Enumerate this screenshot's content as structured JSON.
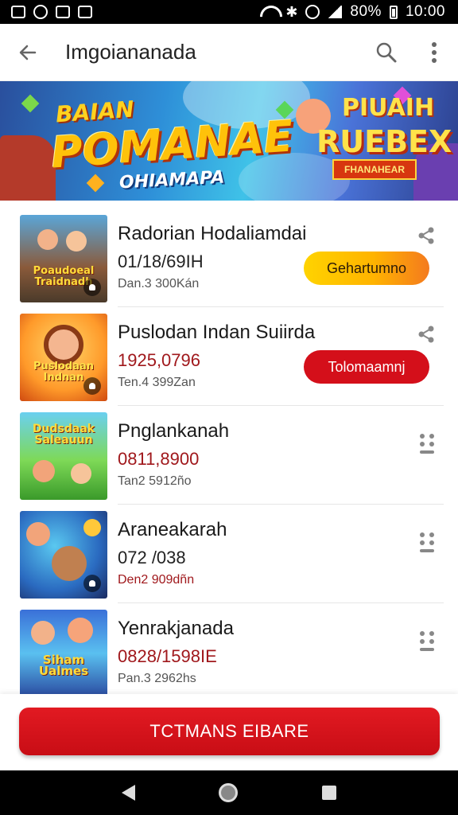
{
  "status_bar": {
    "battery": "80%",
    "time": "10:00",
    "left_icons": [
      "notification-icon",
      "circle-icon",
      "mail-icon",
      "photo-icon"
    ]
  },
  "app_bar": {
    "title": "Imgoiananada",
    "icons": [
      "back-arrow-icon",
      "search-icon",
      "more-vert-icon"
    ]
  },
  "banner": {
    "title_small": "BAIAN",
    "title_big": "POMANAE",
    "subtitle": "OHIAMAPA",
    "right_top": "PIUAIH",
    "right_big": "RUEBEX",
    "right_tag": "FHANAHEAR"
  },
  "items": [
    {
      "name": "Radorian Hodaliamdai",
      "value": "01/18/69IH",
      "meta": "Dan.3 300Kán",
      "thumb_caption": "Poaudoeal Traidnadh",
      "action_label": "Gehartumno",
      "action_style": "gold",
      "side_icon": "share-icon",
      "value_style": "dark",
      "meta_style": "grey"
    },
    {
      "name": "Puslodan Indan Suiirda",
      "value": "1925,0796",
      "meta": "Ten.4 399Zan",
      "thumb_caption": "Puslodaan Indnan",
      "action_label": "Tolomaamnj",
      "action_style": "red",
      "side_icon": "share-icon",
      "value_style": "red",
      "meta_style": "grey"
    },
    {
      "name": "Pnglankanah",
      "value": "0811,8900",
      "meta": "Tan2 5912ño",
      "thumb_caption": "Dudsdaak Saleauun",
      "side_icon": "drag-handle-icon",
      "value_style": "red",
      "meta_style": "grey"
    },
    {
      "name": "Araneakarah",
      "value": "072 /038",
      "meta": "Den2 909dñn",
      "thumb_caption": "",
      "side_icon": "drag-handle-icon",
      "value_style": "dark",
      "meta_style": "red"
    },
    {
      "name": "Yenrakjanada",
      "value": "0828/1598IE",
      "meta": "Pan.3 2962hs",
      "thumb_caption": "Siham Ualmes",
      "side_icon": "drag-handle-icon",
      "value_style": "red",
      "meta_style": "grey"
    }
  ],
  "cta": {
    "label": "TCTMANS EIBARE"
  },
  "nav_bar": {
    "icons": [
      "nav-back-icon",
      "nav-home-icon",
      "nav-recents-icon"
    ]
  },
  "colors": {
    "accent_red": "#d40f1a",
    "gold": "#ffc20a",
    "text_red": "#a0181c"
  }
}
